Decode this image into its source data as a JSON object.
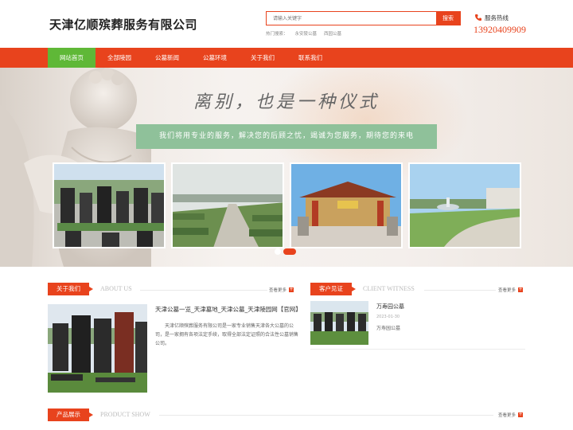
{
  "header": {
    "logo": "天津亿顺殡葬服务有限公司",
    "search_placeholder": "请输入关键字",
    "search_button": "搜索",
    "hot_label": "热门搜索：",
    "hot_links": [
      "永安陵公墓",
      "西园公墓"
    ],
    "hotline_label": "服务热线",
    "hotline_number": "13920409909"
  },
  "nav": {
    "items": [
      "网站首页",
      "全部陵园",
      "公墓新闻",
      "公墓环境",
      "关于我们",
      "联系我们"
    ],
    "active_index": 0
  },
  "banner": {
    "slogan": "离别，也是一种仪式",
    "subtitle": "我们将用专业的服务，解决您的后顾之忧，竭诚为您服务，期待您的来电"
  },
  "about": {
    "title": "关于我们",
    "title_en": "ABOUT US",
    "more": "查看更多",
    "headline": "天津公墓一览_天津墓地_天津公墓_天津陵园网【官网】",
    "desc": "天津亿顺殡葬服务有限公司是一家专业销售天津各大公墓的公司，是一家拥有各项法定手续，取得全部法定证照的合法性公墓销售公司。"
  },
  "cases": {
    "title": "客户见证",
    "title_en": "CLIENT WITNESS",
    "more": "查看更多",
    "items": [
      {
        "name": "万寿园公墓",
        "date": "2023-01-30",
        "desc": "万寿园公墓"
      }
    ]
  },
  "products": {
    "title": "产品展示",
    "title_en": "PRODUCT SHOW",
    "more": "查看更多"
  },
  "colors": {
    "accent": "#e8431d",
    "nav_active": "#5fb837",
    "banner_band": "#8fc19a"
  }
}
